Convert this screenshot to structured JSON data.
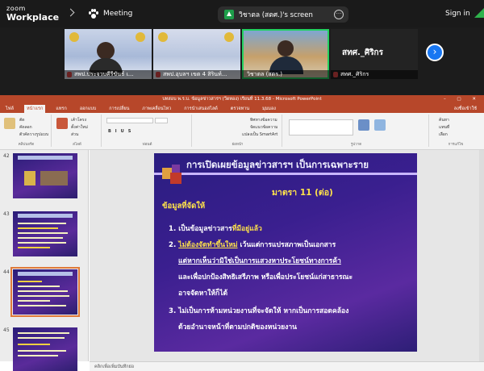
{
  "zoom": {
    "logo_line1": "zoom",
    "logo_line2": "Workplace",
    "meeting_label": "Meeting",
    "share_label": "วิชาตล (สตศ.)'s screen",
    "signin_label": "Sign in"
  },
  "participants": [
    {
      "name": "สพป.ประจวบคีรีขันธ์ เ..."
    },
    {
      "name": "สพป.อุบลฯ เขต 4 สิรินท์..."
    },
    {
      "name": "วิชาตล (สตร.)"
    },
    {
      "name": "สทศ._ศิริกร",
      "big_name": "สทศ._ศิริกร"
    }
  ],
  "powerpoint": {
    "window_title": "บทสอบ พ.ร.บ. ข้อมูลข่าวสารฯ (วีดทอง) เรียนที่ 11.3.68 - Microsoft PowerPoint",
    "tabs": [
      "ไฟล์",
      "หน้าแรก",
      "แทรก",
      "ออกแบบ",
      "การเปลี่ยน",
      "ภาพเคลื่อนไหว",
      "การนำเสนอสไลด์",
      "ตรวจทาน",
      "มุมมอง"
    ],
    "tab_right": "ลงชื่อเข้าใช้",
    "ribbon_labels": [
      "คลิปบอร์ด",
      "สไลด์",
      "ฟอนต์",
      "ย่อหน้า",
      "รูปวาด",
      "การแก้ไข"
    ],
    "ribbon_items": [
      "ตัด",
      "คัดลอก",
      "ตัวคัดวางรูปแบบ",
      "เค้าโครง",
      "ตั้งค่าใหม่",
      "ส่วน",
      "ทิศทางข้อความ",
      "จัดแนวข้อความ",
      "แปลงเป็น SmartArt",
      "ค้นหา",
      "แทนที่",
      "เลือก"
    ],
    "notes_placeholder": "คลิกเพื่อเพิ่มบันทึกย่อ",
    "thumb_numbers": [
      "42",
      "43",
      "44",
      "45"
    ]
  },
  "slide": {
    "title": "การเปิดเผยข้อมูลข่าวสารฯ เป็นการเฉพาะราย",
    "subtitle": "มาตรา 11 (ต่อ)",
    "heading": "ข้อมูลที่จัดให้",
    "line1_a": "1. เป็นข้อมูลข่าวสาร",
    "line1_b": "ที่มีอยู่แล้ว",
    "line2_a": "2. ",
    "line2_b": "ไม่ต้องจัดทำขึ้นใหม่",
    "line2_c": " เว้นแต่การแปรสภาพเป็นเอกสาร",
    "line3": "แต่หากเห็นว่ามิใช่เป็นการแสวงหาประโยชน์ทางการค้า",
    "line4": "และเพื่อปกป้องสิทธิเสรีภาพ หรือเพื่อประโยชน์แก่สาธารณะ",
    "line5": "อาจจัดหาให้ก็ได้",
    "line6": "3. ไม่เป็นการห้ามหน่วยงานที่จะจัดให้ หากเป็นการสอดคล้อง",
    "line7": "ด้วยอำนาจหน้าที่ตามปกติของหน่วยงาน"
  },
  "colors": {
    "zoom_bg": "#1a1a1a",
    "active_border": "#23d160",
    "ppt_accent": "#b7472a",
    "slide_title": "#f1f1ff",
    "slide_yellow": "#ffe34a"
  }
}
